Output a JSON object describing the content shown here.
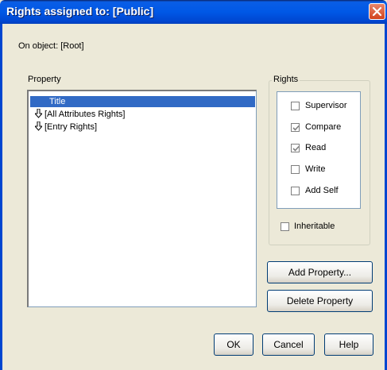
{
  "window": {
    "title": "Rights assigned to: [Public]"
  },
  "object_label": "On object: [Root]",
  "property": {
    "label": "Property",
    "items": [
      "Title",
      "[All Attributes Rights]",
      "[Entry Rights]"
    ]
  },
  "rights": {
    "label": "Rights",
    "items": [
      {
        "label": "Supervisor",
        "checked": false
      },
      {
        "label": "Compare",
        "checked": true
      },
      {
        "label": "Read",
        "checked": true
      },
      {
        "label": "Write",
        "checked": false
      },
      {
        "label": "Add Self",
        "checked": false
      }
    ],
    "inheritable": {
      "label": "Inheritable",
      "checked": false
    }
  },
  "buttons": {
    "add_property": "Add Property...",
    "delete_property": "Delete Property",
    "ok": "OK",
    "cancel": "Cancel",
    "help": "Help"
  },
  "icons": {
    "close": "close-icon",
    "arrow": "down-arrow-icon"
  },
  "colors": {
    "title_bar": "#0058e6",
    "selection": "#316ac5",
    "background": "#ece9d8"
  }
}
